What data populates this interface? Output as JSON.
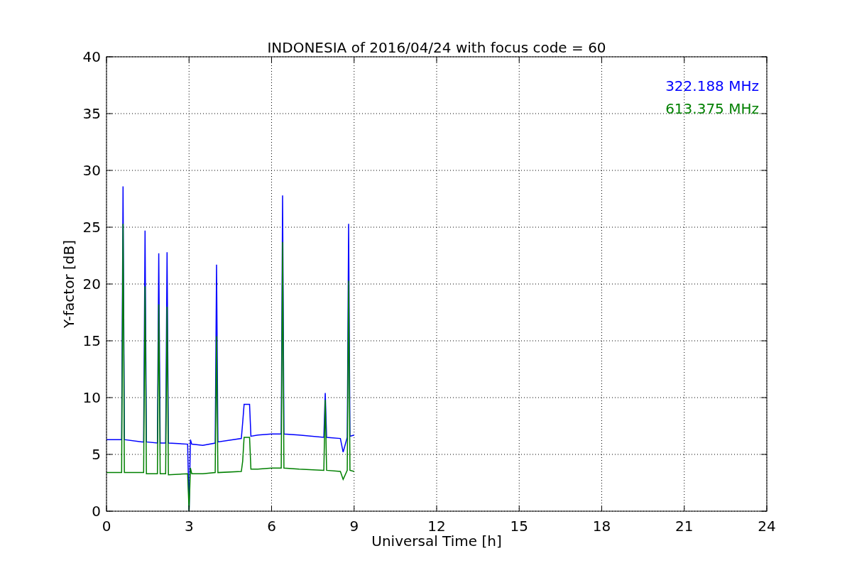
{
  "chart_data": {
    "type": "line",
    "title": "INDONESIA of 2016/04/24 with focus code = 60",
    "xlabel": "Universal Time [h]",
    "ylabel": "Y-factor [dB]",
    "x": [
      0,
      0.5,
      0.55,
      0.6,
      0.65,
      1.3,
      1.35,
      1.4,
      1.45,
      1.85,
      1.9,
      1.95,
      2.15,
      2.2,
      2.25,
      2.95,
      3.0,
      3.05,
      3.1,
      3.5,
      3.95,
      4.0,
      4.05,
      4.9,
      4.95,
      5.0,
      5.2,
      5.25,
      5.5,
      6.0,
      6.35,
      6.4,
      6.45,
      7.0,
      7.9,
      7.95,
      8.0,
      8.5,
      8.6,
      8.75,
      8.8,
      8.85,
      9.0
    ],
    "series": [
      {
        "name": "322.188 MHz",
        "color": "#0000ff",
        "values": [
          6.3,
          6.3,
          6.3,
          28.6,
          6.3,
          6.1,
          6.1,
          24.7,
          6.1,
          6.0,
          22.7,
          6.0,
          6.0,
          22.8,
          6.0,
          5.9,
          0,
          6.3,
          5.9,
          5.8,
          6.0,
          21.7,
          6.1,
          6.4,
          7.8,
          9.4,
          9.4,
          6.6,
          6.7,
          6.8,
          6.8,
          27.8,
          6.8,
          6.7,
          6.5,
          10.4,
          6.5,
          6.4,
          5.2,
          6.5,
          25.3,
          6.6,
          6.7
        ]
      },
      {
        "name": "613.375 MHz",
        "color": "#008000",
        "values": [
          3.4,
          3.4,
          3.4,
          25.3,
          3.4,
          3.4,
          3.4,
          19.8,
          3.3,
          3.3,
          18.2,
          3.3,
          3.3,
          18.0,
          3.2,
          3.3,
          0,
          3.8,
          3.3,
          3.3,
          3.4,
          15.4,
          3.4,
          3.5,
          4.4,
          6.5,
          6.5,
          3.7,
          3.7,
          3.8,
          3.8,
          23.7,
          3.8,
          3.7,
          3.6,
          9.8,
          3.6,
          3.5,
          2.8,
          3.6,
          20.3,
          3.6,
          3.5
        ]
      }
    ],
    "xlim": [
      0,
      24
    ],
    "ylim": [
      0,
      40
    ],
    "xticks": [
      0,
      3,
      6,
      9,
      12,
      15,
      18,
      21,
      24
    ],
    "yticks": [
      0,
      5,
      10,
      15,
      20,
      25,
      30,
      35,
      40
    ],
    "grid": true
  }
}
